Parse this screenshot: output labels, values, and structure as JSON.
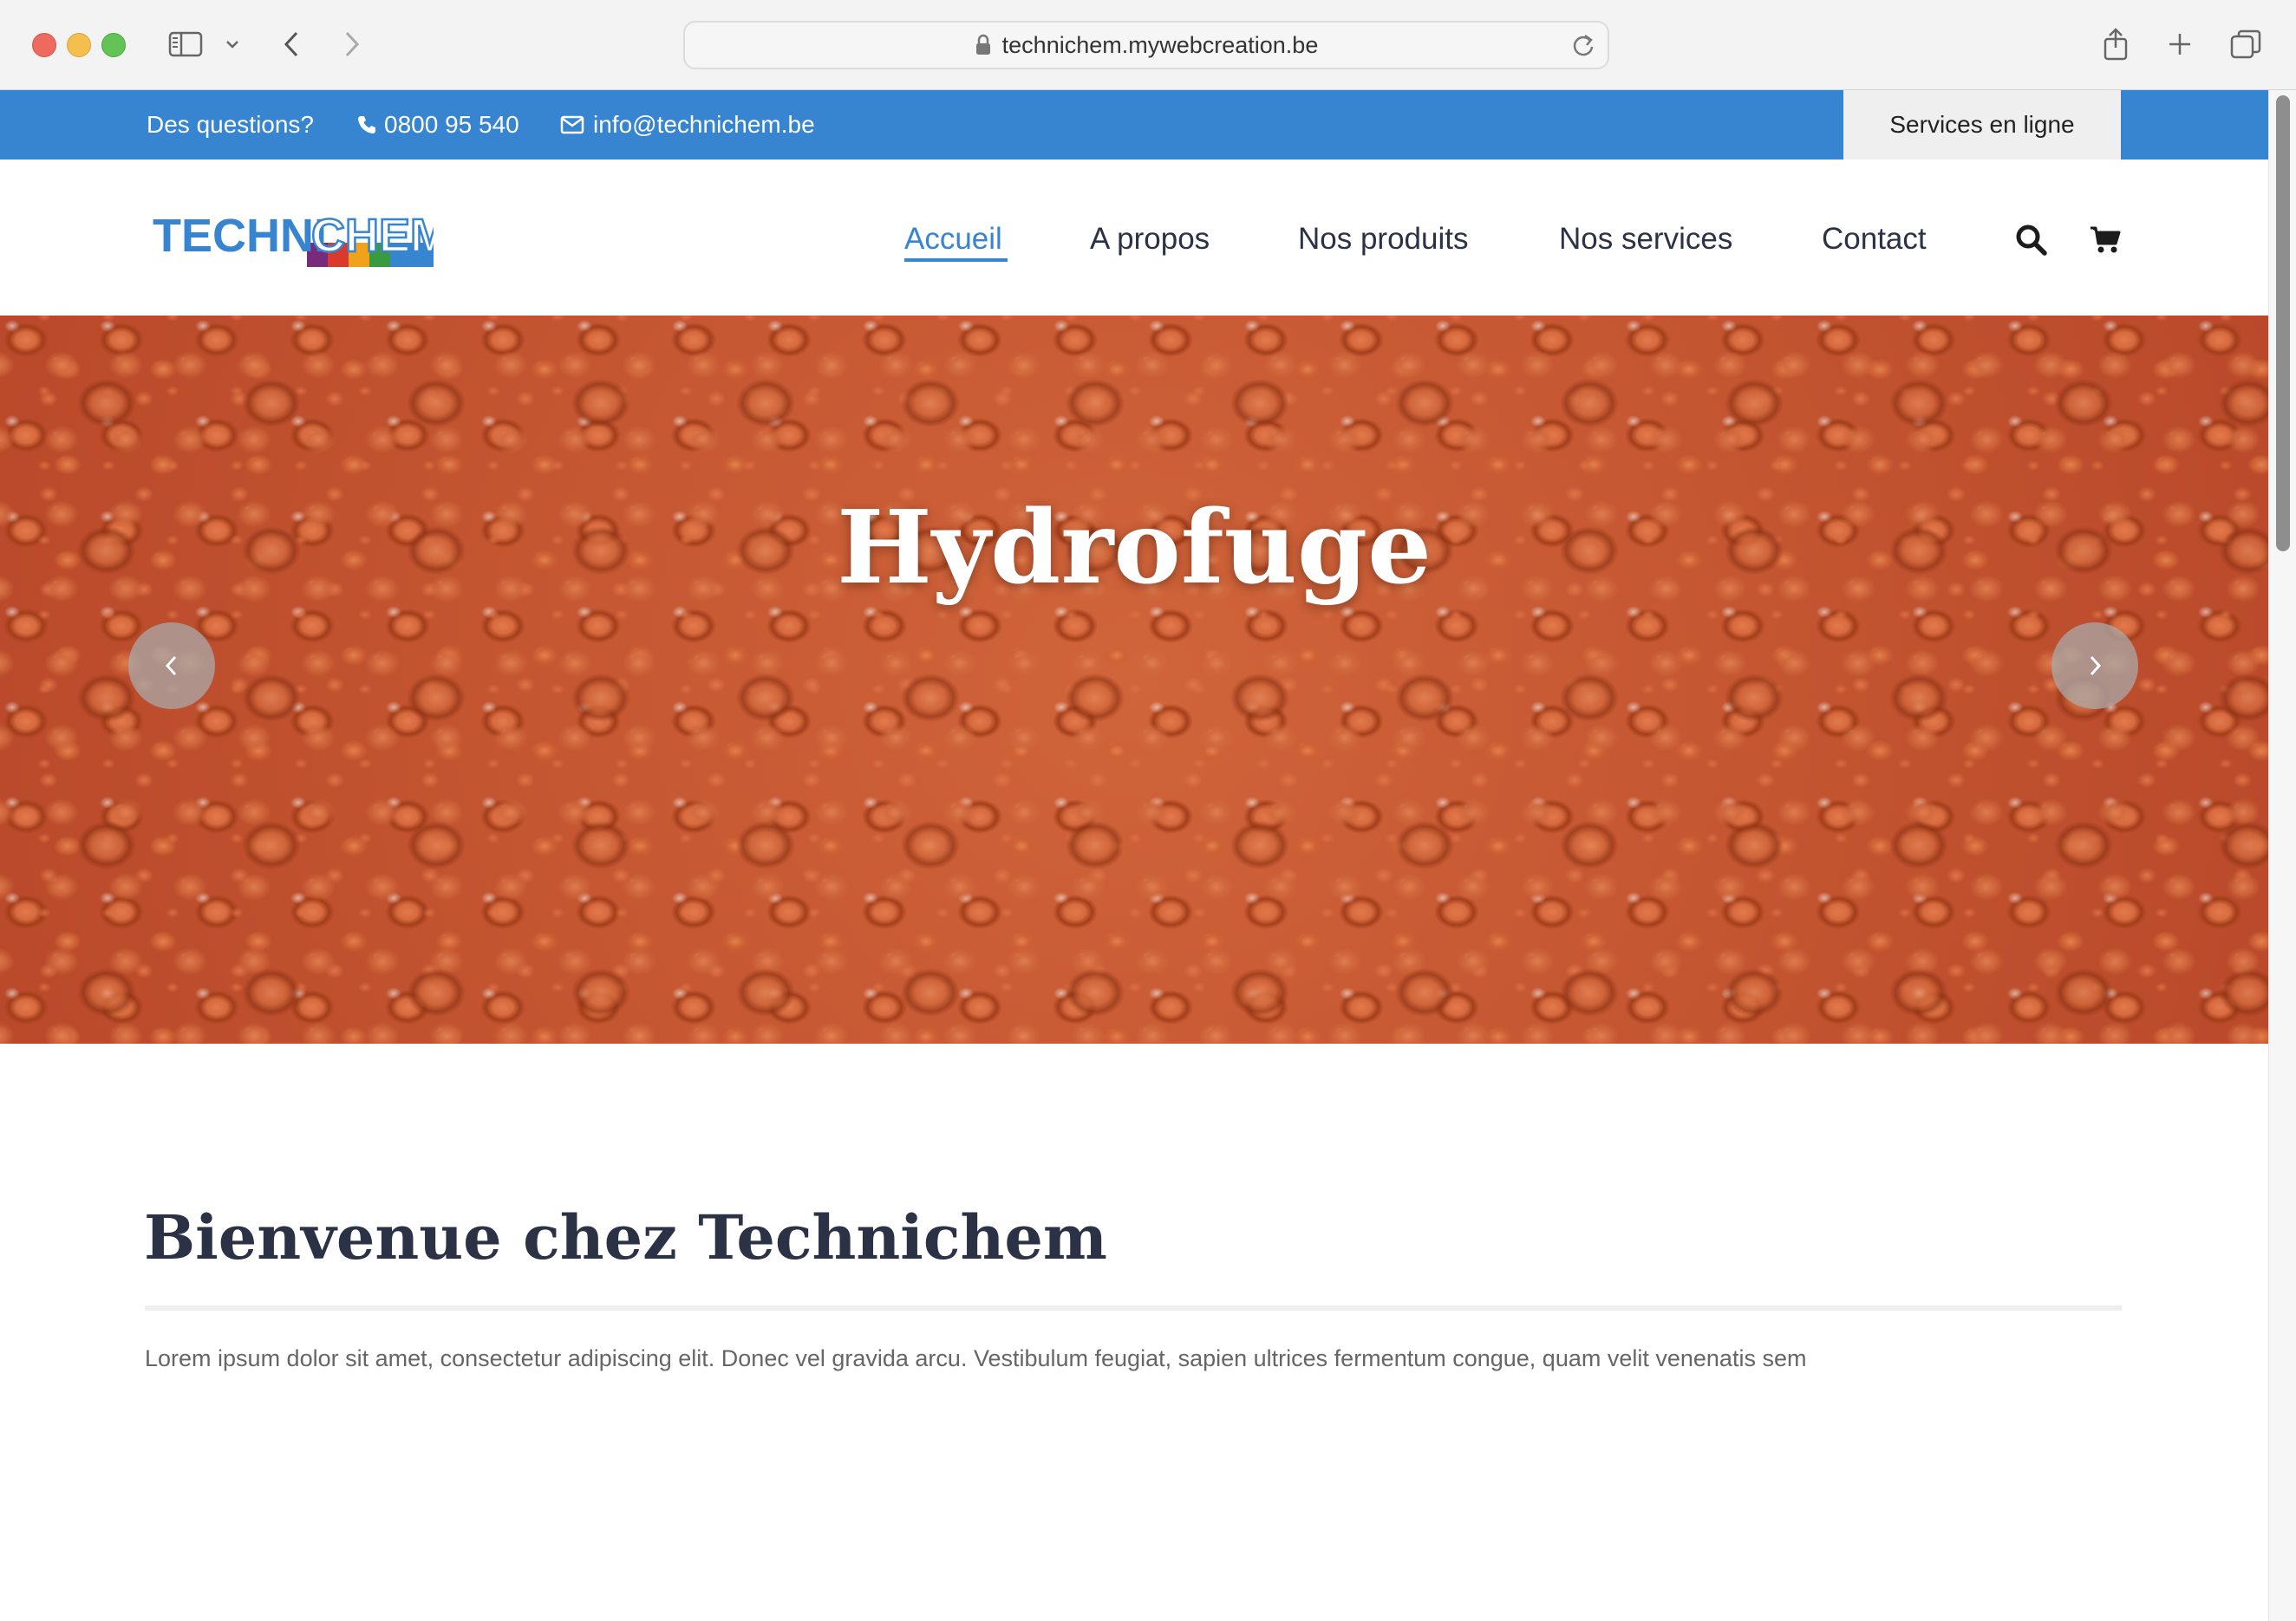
{
  "browser": {
    "url": "technichem.mywebcreation.be"
  },
  "topbar": {
    "question": "Des questions?",
    "phone": "0800 95 540",
    "email": "info@technichem.be",
    "services_label": "Services en ligne",
    "background_color": "#3784d0"
  },
  "header": {
    "logo_text_left": "TECHNI",
    "logo_text_right": "CHEM",
    "nav": [
      {
        "label": "Accueil",
        "active": true
      },
      {
        "label": "A propos",
        "active": false
      },
      {
        "label": "Nos produits",
        "active": false
      },
      {
        "label": "Nos services",
        "active": false
      },
      {
        "label": "Contact",
        "active": false
      }
    ],
    "accent_color": "#3784d0"
  },
  "hero": {
    "title": "Hydrofuge"
  },
  "content": {
    "heading": "Bienvenue chez Technichem",
    "paragraph": "Lorem ipsum dolor sit amet, consectetur adipiscing elit. Donec vel gravida arcu. Vestibulum feugiat, sapien ultrices fermentum congue, quam velit venenatis sem"
  }
}
